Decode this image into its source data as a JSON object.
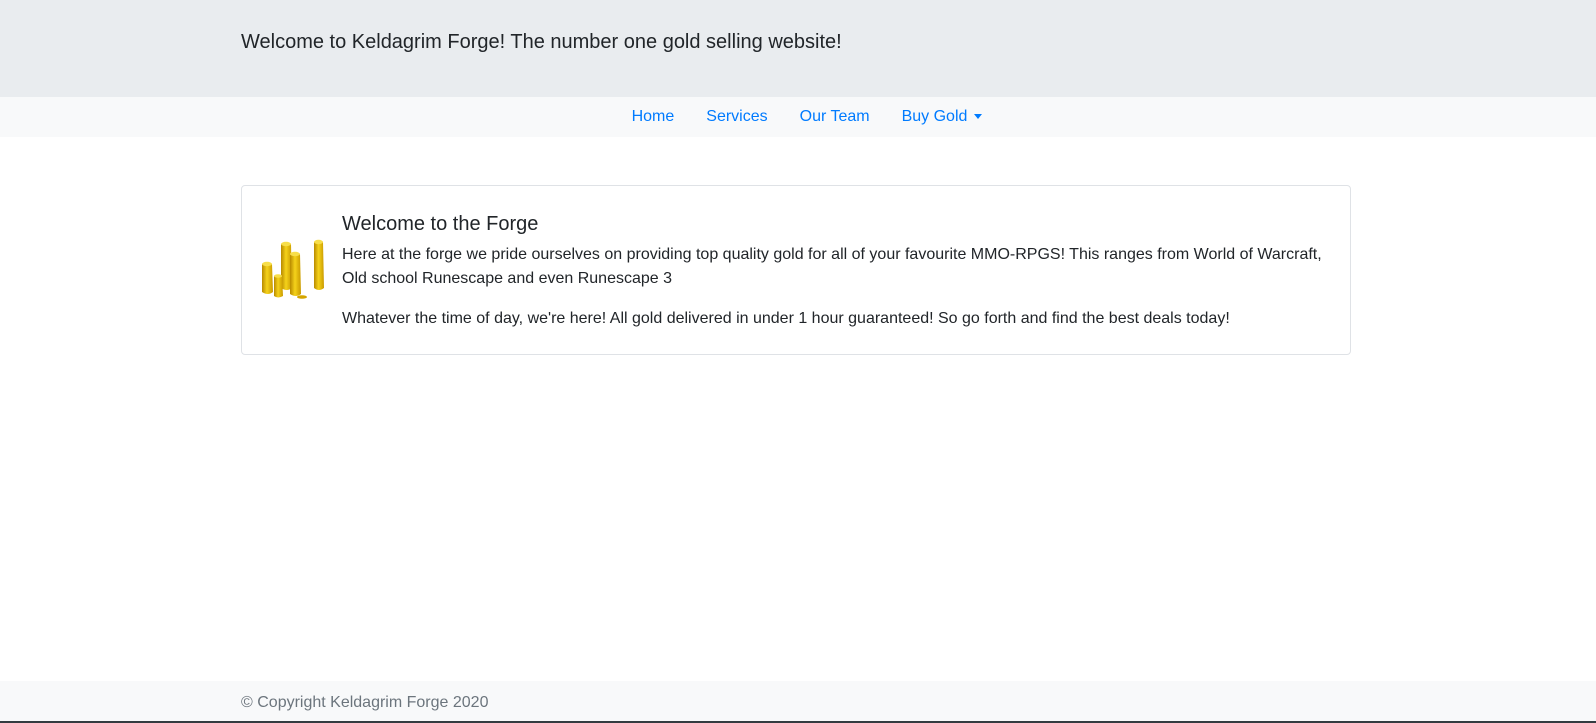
{
  "header": {
    "title": "Welcome to Keldagrim Forge! The number one gold selling website!"
  },
  "nav": {
    "items": [
      {
        "label": "Home"
      },
      {
        "label": "Services"
      },
      {
        "label": "Our Team"
      },
      {
        "label": "Buy Gold"
      }
    ],
    "link_color": "#007bff"
  },
  "main": {
    "card": {
      "image_icon": "gold-coins-icon",
      "heading": "Welcome to the Forge",
      "paragraph_1": "Here at the forge we pride ourselves on providing top quality gold for all of your favourite MMO-RPGS! This ranges from World of Warcraft, Old school Runescape and even Runescape 3",
      "paragraph_2": "Whatever the time of day, we're here! All gold delivered in under 1 hour guaranteed! So go forth and find the best deals today!"
    }
  },
  "footer": {
    "copyright": "© Copyright Keldagrim Forge 2020"
  },
  "colors": {
    "header_bg": "#e9ecef",
    "navbar_bg": "#f8f9fa",
    "gold": "#e8b80a"
  }
}
